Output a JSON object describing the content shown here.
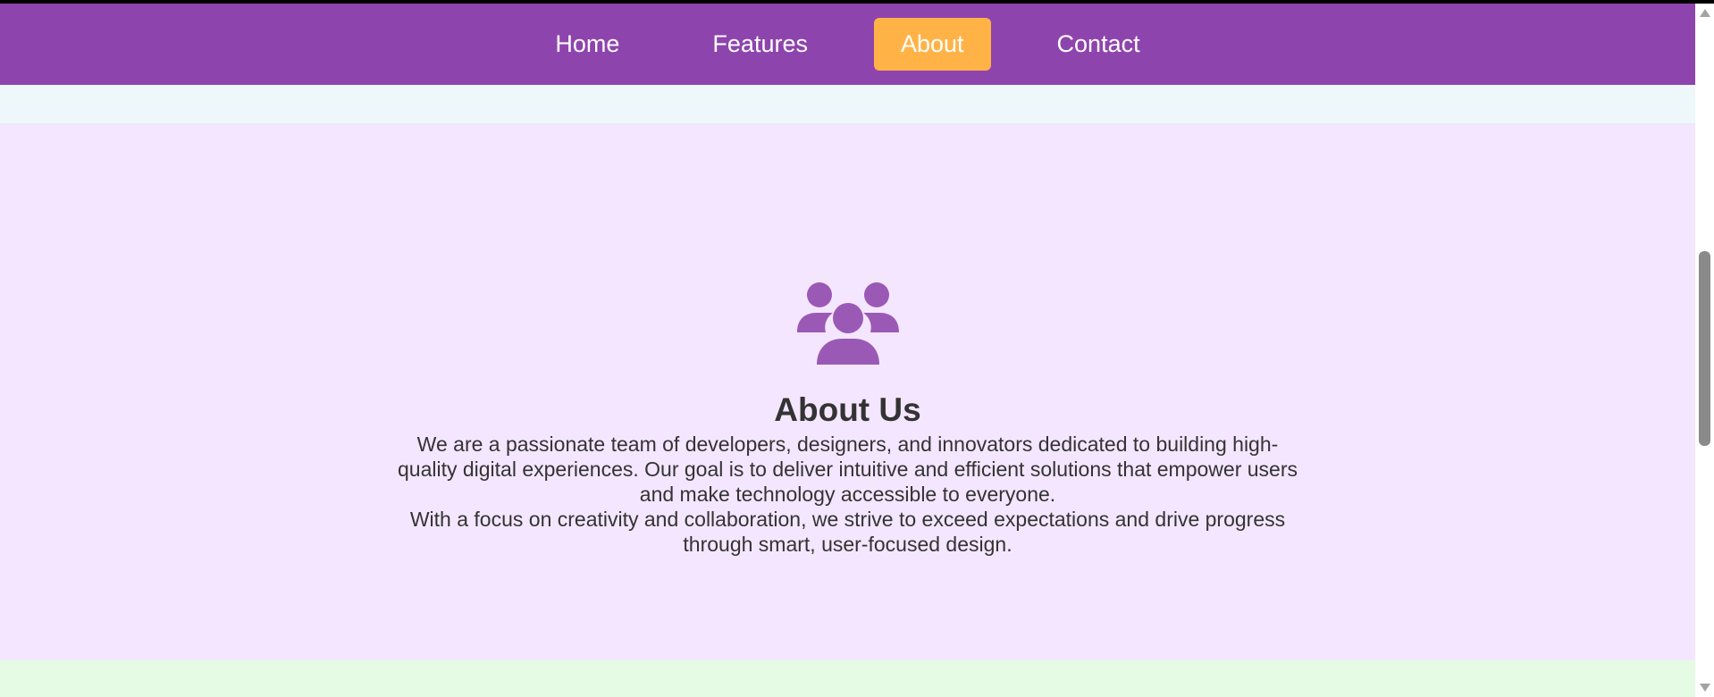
{
  "nav": {
    "items": [
      {
        "label": "Home",
        "active": false
      },
      {
        "label": "Features",
        "active": false
      },
      {
        "label": "About",
        "active": true
      },
      {
        "label": "Contact",
        "active": false
      }
    ]
  },
  "about": {
    "icon": "users-icon",
    "title": "About Us",
    "paragraph_1": "We are a passionate team of developers, designers, and innovators dedicated to building high-quality digital experiences. Our goal is to deliver intuitive and efficient solutions that empower users and make technology accessible to everyone.",
    "paragraph_2": "With a focus on creativity and collaboration, we strive to exceed expectations and drive progress through smart, user-focused design."
  },
  "colors": {
    "nav_background": "#8e44ad",
    "nav_active": "#ffb347",
    "about_background": "#f4e6ff",
    "icon": "#9b59b6",
    "text": "#333333"
  }
}
